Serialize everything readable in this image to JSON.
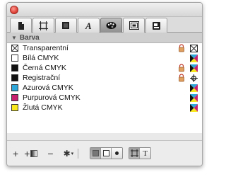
{
  "section": {
    "title": "Barva"
  },
  "swatches": [
    {
      "name": "Transparentní",
      "color": "none",
      "locked": true,
      "type": "none"
    },
    {
      "name": "Bílá CMYK",
      "color": "#ffffff",
      "locked": false,
      "type": "cmyk"
    },
    {
      "name": "Černá CMYK",
      "color": "#111111",
      "locked": true,
      "type": "cmyk"
    },
    {
      "name": "Registrační",
      "color": "#111111",
      "locked": true,
      "type": "registration"
    },
    {
      "name": "Azurová CMYK",
      "color": "#2fa7d8",
      "locked": false,
      "type": "cmyk"
    },
    {
      "name": "Purpurová CMYK",
      "color": "#c8206f",
      "locked": false,
      "type": "cmyk"
    },
    {
      "name": "Žlutá CMYK",
      "color": "#f7e71c",
      "locked": false,
      "type": "cmyk"
    }
  ],
  "footer": {
    "add": "+",
    "add_gradient": "+",
    "remove": "−",
    "gear": "✱",
    "text_mode": "T"
  }
}
